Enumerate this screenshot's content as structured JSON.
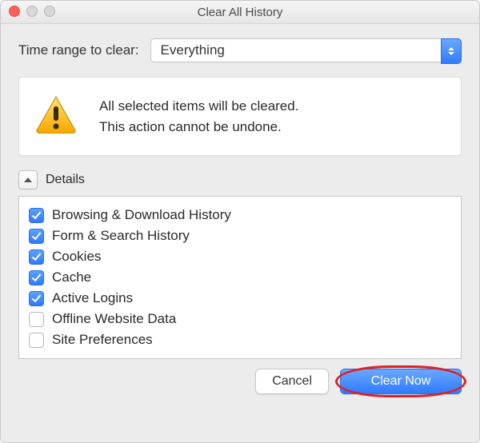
{
  "window": {
    "title": "Clear All History"
  },
  "range": {
    "label": "Time range to clear:",
    "selected": "Everything"
  },
  "warning": {
    "line1": "All selected items will be cleared.",
    "line2": "This action cannot be undone."
  },
  "details": {
    "label": "Details",
    "items": [
      {
        "label": "Browsing & Download History",
        "checked": true
      },
      {
        "label": "Form & Search History",
        "checked": true
      },
      {
        "label": "Cookies",
        "checked": true
      },
      {
        "label": "Cache",
        "checked": true
      },
      {
        "label": "Active Logins",
        "checked": true
      },
      {
        "label": "Offline Website Data",
        "checked": false
      },
      {
        "label": "Site Preferences",
        "checked": false
      }
    ]
  },
  "buttons": {
    "cancel": "Cancel",
    "clear": "Clear Now"
  }
}
